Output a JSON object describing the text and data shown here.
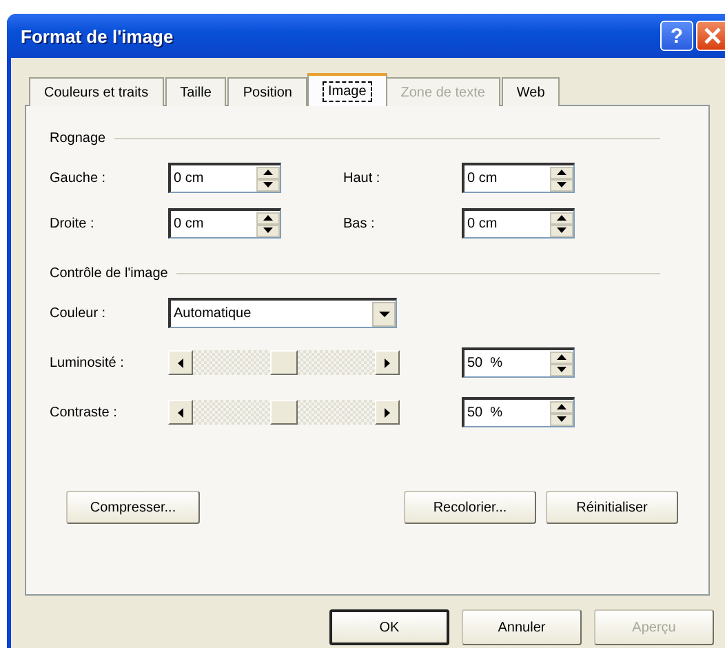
{
  "window": {
    "title": "Format de l'image",
    "help_button": "?"
  },
  "tabs": [
    {
      "label": "Couleurs et traits",
      "selected": false,
      "disabled": false
    },
    {
      "label": "Taille",
      "selected": false,
      "disabled": false
    },
    {
      "label": "Position",
      "selected": false,
      "disabled": false
    },
    {
      "label": "Image",
      "selected": true,
      "disabled": false
    },
    {
      "label": "Zone de texte",
      "selected": false,
      "disabled": true
    },
    {
      "label": "Web",
      "selected": false,
      "disabled": false
    }
  ],
  "cropping": {
    "title": "Rognage",
    "fields": [
      {
        "label": "Gauche :",
        "value": "0 cm"
      },
      {
        "label": "Haut :",
        "value": "0 cm"
      },
      {
        "label": "Droite :",
        "value": "0 cm"
      },
      {
        "label": "Bas :",
        "value": "0 cm"
      }
    ]
  },
  "image_control": {
    "title": "Contrôle de l'image",
    "color": {
      "label": "Couleur :",
      "value": "Automatique"
    },
    "sliders": [
      {
        "label": "Luminosité :",
        "level": 0.5,
        "value": "50  %"
      },
      {
        "label": "Contraste :",
        "level": 0.5,
        "value": "50  %"
      }
    ]
  },
  "panel_buttons": [
    "Compresser...",
    "Recolorier...",
    "Réinitialiser"
  ],
  "buttons": [
    {
      "label": "OK",
      "default": true,
      "disabled": false
    },
    {
      "label": "Annuler",
      "default": false,
      "disabled": false
    },
    {
      "label": "Aperçu",
      "default": false,
      "disabled": true
    }
  ]
}
